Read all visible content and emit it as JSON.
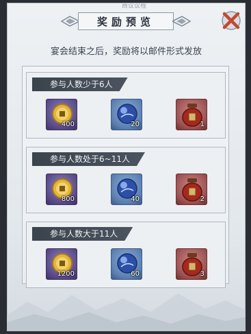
{
  "window": {
    "top_ghost_text": "商议议程",
    "title": "奖励预览",
    "notice": "宴会结束之后，奖励将以邮件形式发放"
  },
  "sections": [
    {
      "header": "参与人数少于6人",
      "rewards": [
        {
          "icon": "gold-coin-icon",
          "count": "400",
          "frame": "purple"
        },
        {
          "icon": "blue-orb-icon",
          "count": "20",
          "frame": "blue"
        },
        {
          "icon": "wine-jar-icon",
          "count": "1",
          "frame": "red"
        }
      ]
    },
    {
      "header": "参与人数处于6~11人",
      "rewards": [
        {
          "icon": "gold-coin-icon",
          "count": "800",
          "frame": "purple"
        },
        {
          "icon": "blue-orb-icon",
          "count": "40",
          "frame": "blue"
        },
        {
          "icon": "wine-jar-icon",
          "count": "2",
          "frame": "red"
        }
      ]
    },
    {
      "header": "参与人数大于11人",
      "rewards": [
        {
          "icon": "gold-coin-icon",
          "count": "1200",
          "frame": "purple"
        },
        {
          "icon": "blue-orb-icon",
          "count": "60",
          "frame": "blue"
        },
        {
          "icon": "wine-jar-icon",
          "count": "3",
          "frame": "red"
        }
      ]
    }
  ],
  "colors": {
    "panel_bg": "#e8ecf0",
    "header_bg": "#3b434d",
    "close_accent": "#c2492f"
  }
}
